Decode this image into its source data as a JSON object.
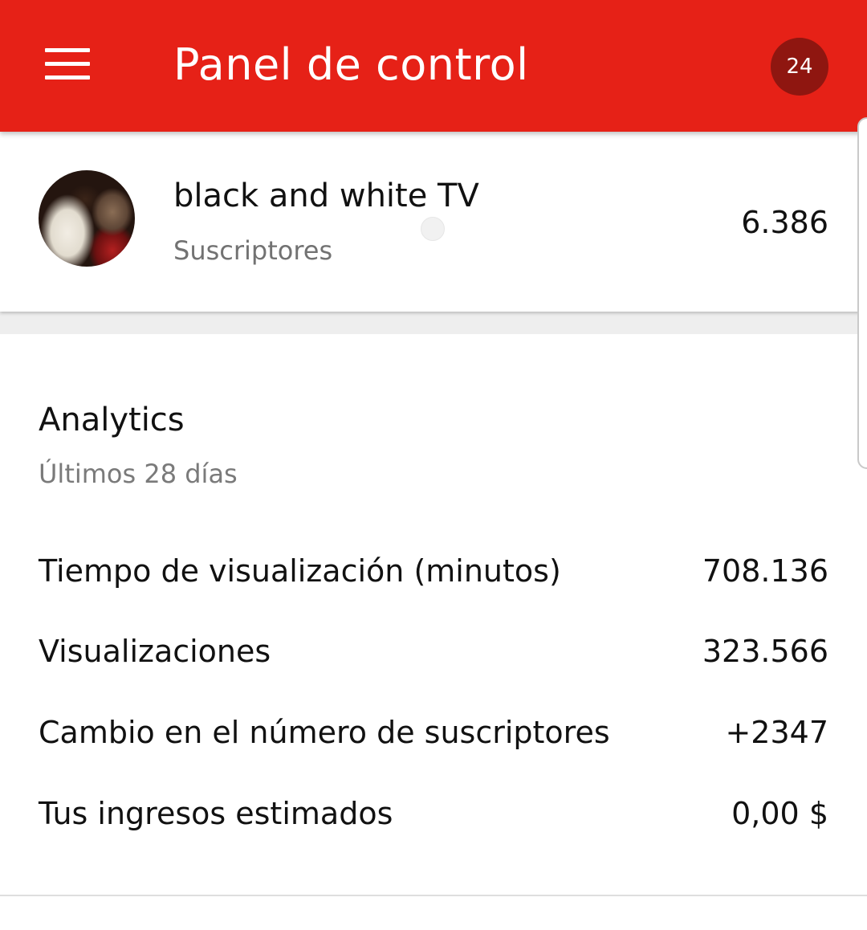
{
  "app_bar": {
    "title": "Panel de control",
    "notification_count": "24",
    "colors": {
      "bar": "#e62117",
      "badge": "#8f1610"
    },
    "menu_icon": "hamburger-menu-icon"
  },
  "channel": {
    "name": "black and white TV",
    "subscribers_label": "Suscriptores",
    "subscribers_count": "6.386"
  },
  "analytics": {
    "title": "Analytics",
    "period": "Últimos 28 días",
    "metrics": [
      {
        "label": "Tiempo de visualización (minutos)",
        "value": "708.136"
      },
      {
        "label": "Visualizaciones",
        "value": "323.566"
      },
      {
        "label": "Cambio en el número de suscriptores",
        "value": "+2347"
      },
      {
        "label": "Tus ingresos estimados",
        "value": "0,00 $"
      }
    ]
  }
}
